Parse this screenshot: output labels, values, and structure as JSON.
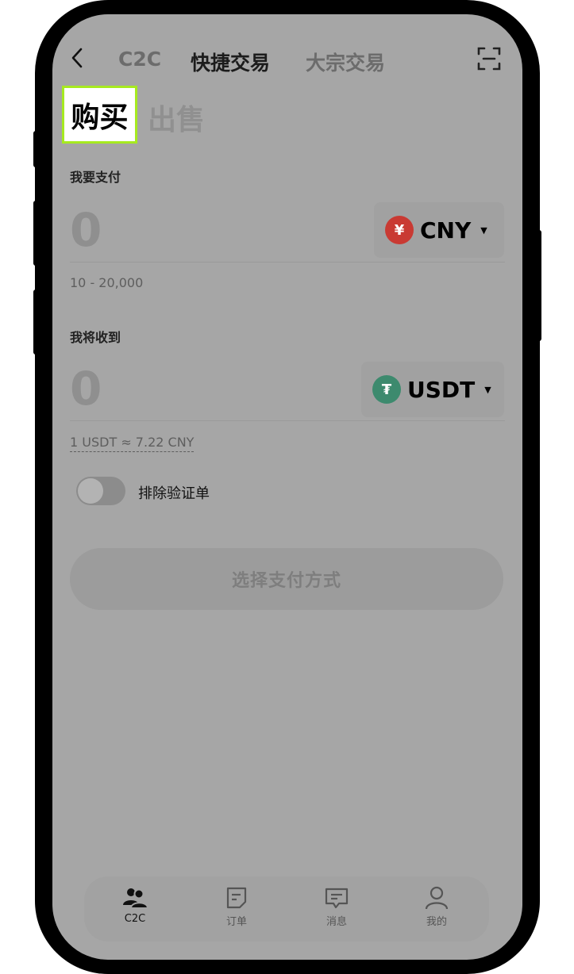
{
  "header": {
    "tabs": [
      {
        "label": "C2C"
      },
      {
        "label": "快捷交易"
      },
      {
        "label": "大宗交易"
      }
    ]
  },
  "trade_tabs": {
    "buy": "购买",
    "sell": "出售"
  },
  "pay": {
    "label": "我要支付",
    "amount": "0",
    "currency": "CNY",
    "currency_symbol": "¥",
    "range": "10 - 20,000"
  },
  "receive": {
    "label": "我将收到",
    "amount": "0",
    "currency": "USDT",
    "currency_symbol": "₮",
    "rate": "1 USDT ≈ 7.22 CNY"
  },
  "filter": {
    "label": "排除验证单",
    "enabled": false
  },
  "cta": {
    "label": "选择支付方式"
  },
  "bottom_nav": {
    "items": [
      {
        "label": "C2C",
        "icon": "users-icon"
      },
      {
        "label": "订单",
        "icon": "document-icon"
      },
      {
        "label": "消息",
        "icon": "message-icon"
      },
      {
        "label": "我的",
        "icon": "person-icon"
      }
    ]
  },
  "colors": {
    "highlight_border": "#a6ea1f",
    "cny_badge": "#c93a33",
    "usdt_badge": "#3d8a6e"
  }
}
